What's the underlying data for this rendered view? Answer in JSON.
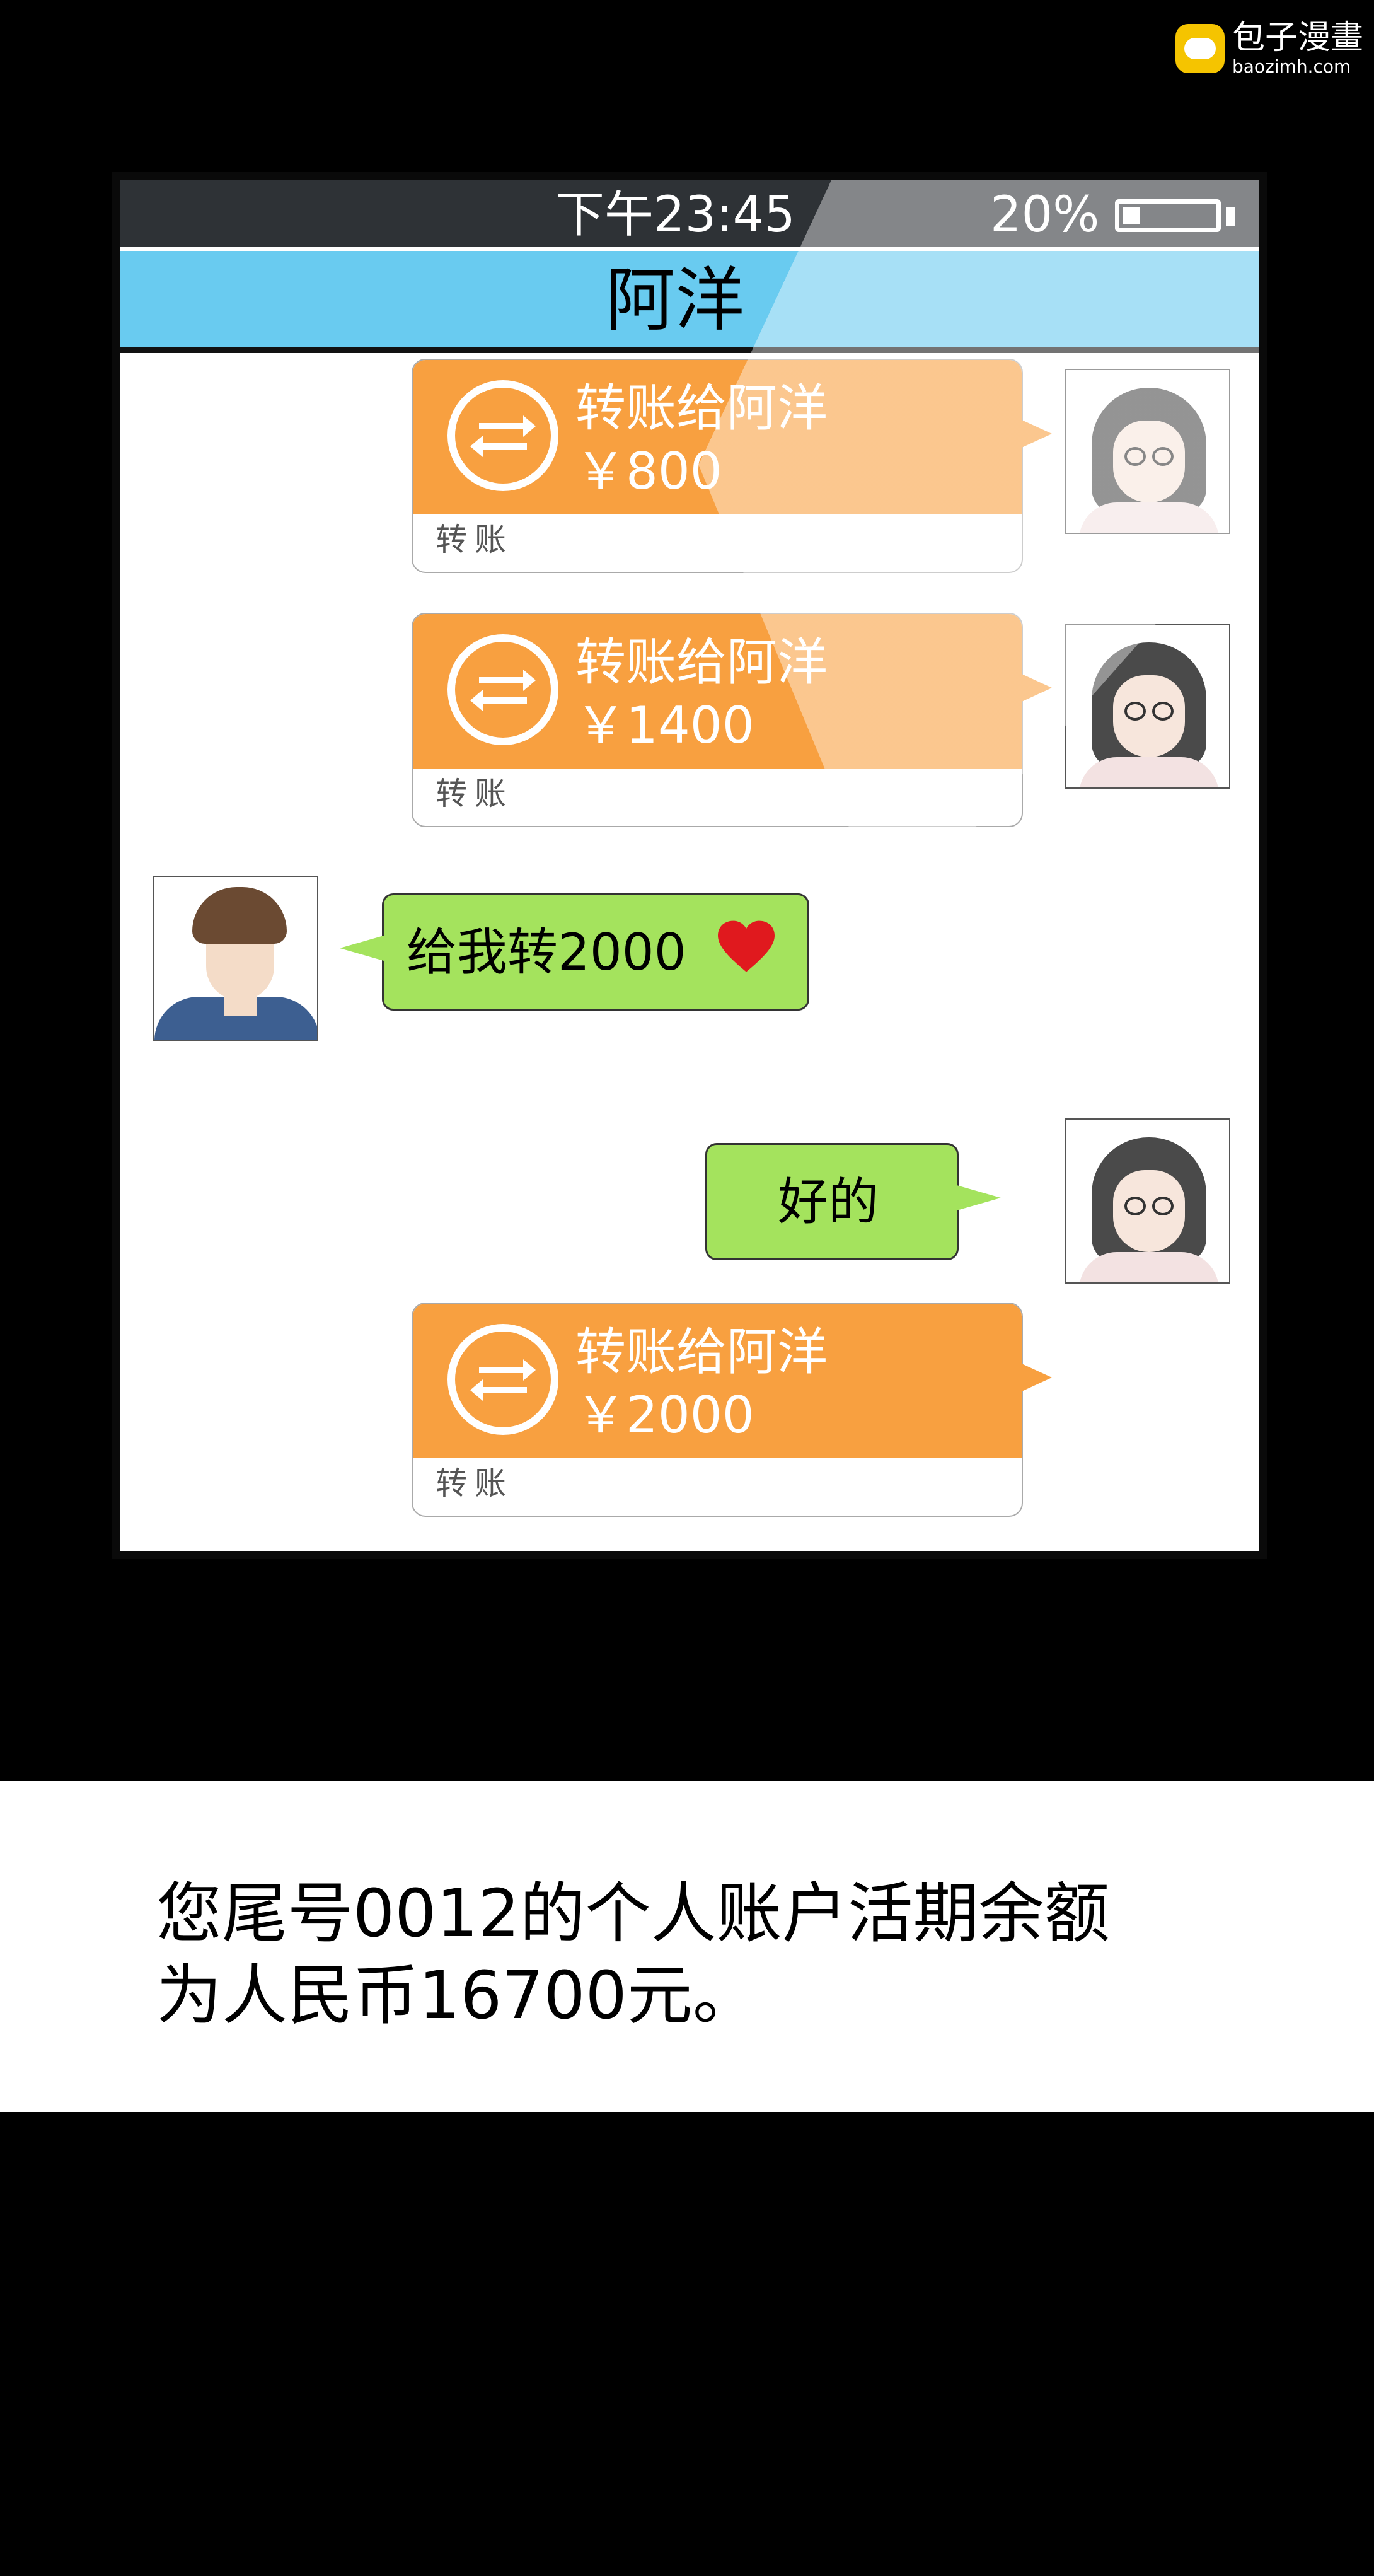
{
  "watermark": {
    "title": "包子漫畫",
    "url": "baozimh.com"
  },
  "status_bar": {
    "time": "下午23:45",
    "battery": "20%",
    "battery_level": 0.2
  },
  "chat": {
    "contact_name": "阿洋",
    "messages": [
      {
        "type": "transfer",
        "side": "right",
        "title": "转账给阿洋",
        "amount": "￥800",
        "footer": "转账"
      },
      {
        "type": "transfer",
        "side": "right",
        "title": "转账给阿洋",
        "amount": "￥1400",
        "footer": "转账"
      },
      {
        "type": "text",
        "side": "left",
        "text": "给我转2000",
        "icon": "heart-icon"
      },
      {
        "type": "text",
        "side": "right",
        "text": "好的"
      },
      {
        "type": "transfer",
        "side": "right",
        "title": "转账给阿洋",
        "amount": "￥2000",
        "footer": "转账"
      }
    ]
  },
  "caption": {
    "line1": "您尾号0012的个人账户活期余额",
    "line2": "为人民币16700元。"
  },
  "colors": {
    "header": "#69cbf0",
    "transfer": "#f8a040",
    "bubble": "#a4e35d",
    "heart": "#e0191e"
  }
}
